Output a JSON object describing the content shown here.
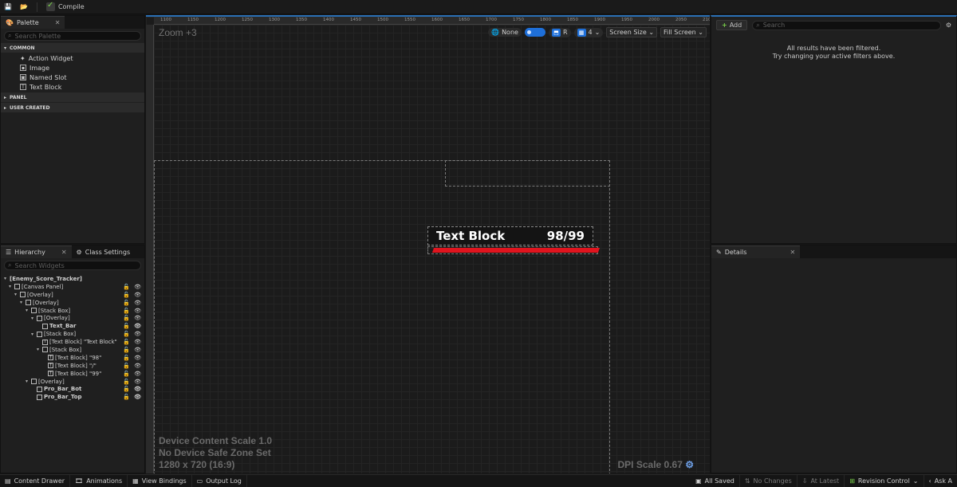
{
  "toolbar": {
    "compile_label": "Compile"
  },
  "palette": {
    "tab_label": "Palette",
    "search_placeholder": "Search Palette",
    "categories": {
      "common": "COMMON",
      "panel": "PANEL",
      "user_created": "USER CREATED"
    },
    "items": [
      "Action Widget",
      "Image",
      "Named Slot",
      "Text Block"
    ]
  },
  "hierarchy": {
    "tab_label": "Hierarchy",
    "class_settings_label": "Class Settings",
    "search_placeholder": "Search Widgets",
    "rows": [
      "[Enemy_Score_Tracker]",
      "[Canvas Panel]",
      "[Overlay]",
      "[Overlay]",
      "[Stack Box]",
      "[Overlay]",
      "Text_Bar",
      "[Stack Box]",
      "[Text Block] \"Text Block\"",
      "[Stack Box]",
      "[Text Block] \"98\"",
      "[Text Block] \"/\"",
      "[Text Block] \"99\"",
      "[Overlay]",
      "Pro_Bar_Bot",
      "Pro_Bar_Top"
    ]
  },
  "designer": {
    "zoom_label": "Zoom +3",
    "ruler_ticks": [
      "1100",
      "1150",
      "1200",
      "1250",
      "1300",
      "1350",
      "1400",
      "1450",
      "1500",
      "1550",
      "1600",
      "1650",
      "1700",
      "1750",
      "1800",
      "1850",
      "1900",
      "1950",
      "2000",
      "2050",
      "210"
    ],
    "none_label": "None",
    "r_label": "R",
    "grid_value": "4",
    "screen_size_label": "Screen Size",
    "fill_screen_label": "Fill Screen",
    "device_content_scale": "Device Content Scale 1.0",
    "safe_zone": "No Device Safe Zone Set",
    "resolution": "1280 x 720 (16:9)",
    "dpi_scale": "DPI Scale 0.67",
    "widget_text": "Text Block",
    "widget_score": "98/99"
  },
  "details_top": {
    "add_label": "Add",
    "search_placeholder": "Search",
    "filtered_line1": "All results have been filtered.",
    "filtered_line2": "Try changing your active filters above."
  },
  "details": {
    "tab_label": "Details"
  },
  "statusbar": {
    "content_drawer": "Content Drawer",
    "animations": "Animations",
    "view_bindings": "View Bindings",
    "output_log": "Output Log",
    "all_saved": "All Saved",
    "no_changes": "No Changes",
    "at_latest": "At Latest",
    "revision_control": "Revision Control",
    "ask": "Ask A"
  }
}
